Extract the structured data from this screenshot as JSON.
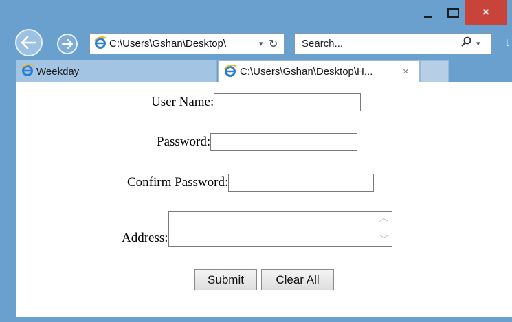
{
  "window": {
    "caption_buttons": {
      "minimize": "minimize-icon",
      "maximize": "maximize-icon",
      "close": "×"
    }
  },
  "nav": {
    "back_icon": "arrow-left-icon",
    "forward_icon": "arrow-right-icon",
    "address": "C:\\Users\\Gshan\\Desktop\\",
    "address_dropdown": "▾",
    "refresh": "↻",
    "search_placeholder": "Search...",
    "search_icon": "⚲",
    "search_dropdown": "▾",
    "overflow": "t"
  },
  "tabs": [
    {
      "label": "Weekday",
      "icon": "ie-icon"
    },
    {
      "label": "C:\\Users\\Gshan\\Desktop\\H...",
      "icon": "ie-icon",
      "close": "×"
    }
  ],
  "form": {
    "username_label": "User Name:",
    "password_label": "Password:",
    "confirm_label": "Confirm Password:",
    "address_label": "Address:",
    "submit_label": "Submit",
    "clear_label": "Clear All"
  },
  "colors": {
    "frame": "#6aa0cd",
    "close_button": "#c8443b",
    "tab_inactive": "#a3c4e2"
  }
}
